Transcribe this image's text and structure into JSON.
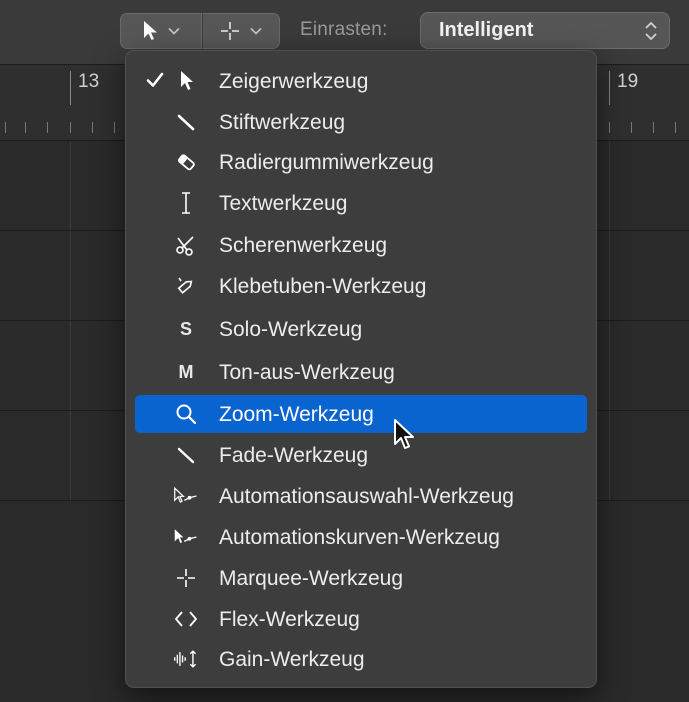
{
  "toolbar": {
    "left_tool_icon": "pointer-arrow-icon",
    "right_tool_icon": "marquee-crosshair-icon",
    "snap_label": "Einrasten:",
    "snap_value": "Intelligent"
  },
  "ruler": {
    "bar_left": "13",
    "bar_right": "19"
  },
  "menu": {
    "items": [
      {
        "label": "Zeigerwerkzeug",
        "icon": "pointer-icon",
        "checked": true,
        "selected": false
      },
      {
        "label": "Stiftwerkzeug",
        "icon": "pencil-icon",
        "checked": false,
        "selected": false
      },
      {
        "label": "Radiergummiwerkzeug",
        "icon": "eraser-icon",
        "checked": false,
        "selected": false
      },
      {
        "label": "Textwerkzeug",
        "icon": "text-cursor-icon",
        "checked": false,
        "selected": false
      },
      {
        "label": "Scherenwerkzeug",
        "icon": "scissors-icon",
        "checked": false,
        "selected": false
      },
      {
        "label": "Klebetuben-Werkzeug",
        "icon": "glue-icon",
        "checked": false,
        "selected": false
      },
      {
        "label": "Solo-Werkzeug",
        "icon": "solo-icon",
        "icon_text": "S",
        "checked": false,
        "selected": false
      },
      {
        "label": "Ton-aus-Werkzeug",
        "icon": "mute-icon",
        "icon_text": "M",
        "checked": false,
        "selected": false
      },
      {
        "label": "Zoom-Werkzeug",
        "icon": "zoom-icon",
        "checked": false,
        "selected": true
      },
      {
        "label": "Fade-Werkzeug",
        "icon": "fade-icon",
        "checked": false,
        "selected": false
      },
      {
        "label": "Automationsauswahl-Werkzeug",
        "icon": "automation-select-icon",
        "checked": false,
        "selected": false
      },
      {
        "label": "Automationskurven-Werkzeug",
        "icon": "automation-curve-icon",
        "checked": false,
        "selected": false
      },
      {
        "label": "Marquee-Werkzeug",
        "icon": "marquee-icon",
        "checked": false,
        "selected": false
      },
      {
        "label": "Flex-Werkzeug",
        "icon": "flex-icon",
        "checked": false,
        "selected": false
      },
      {
        "label": "Gain-Werkzeug",
        "icon": "gain-icon",
        "checked": false,
        "selected": false
      }
    ]
  },
  "colors": {
    "selection": "#0a64d0",
    "menu_bg": "#3d3d3d",
    "background": "#2a2a2a"
  }
}
